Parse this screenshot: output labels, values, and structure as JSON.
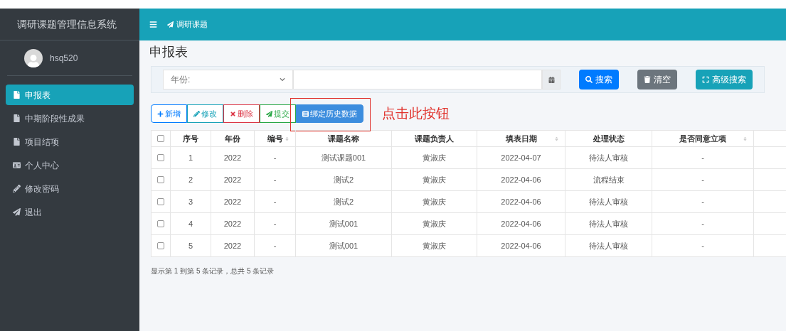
{
  "sidebar": {
    "brand": "调研课题管理信息系统",
    "user": {
      "name": "hsq520"
    },
    "items": [
      {
        "label": "申报表",
        "selected": true
      },
      {
        "label": "中期阶段性成果",
        "selected": false
      },
      {
        "label": "项目结项",
        "selected": false
      },
      {
        "label": "个人中心",
        "selected": false
      },
      {
        "label": "修改密码",
        "selected": false
      },
      {
        "label": "退出",
        "selected": false
      }
    ]
  },
  "header": {
    "breadcrumb": "调研课题"
  },
  "page_title": "申报表",
  "search": {
    "year_select": {
      "placeholder": "年份:"
    },
    "buttons": [
      {
        "kind": "search",
        "label": "搜索"
      },
      {
        "kind": "clear",
        "label": "清空"
      },
      {
        "kind": "advanced",
        "label": "高级搜索"
      }
    ]
  },
  "toolbar": [
    {
      "kind": "add",
      "label": "新增",
      "highlighted": false
    },
    {
      "kind": "edit",
      "label": "修改",
      "highlighted": false
    },
    {
      "kind": "delete",
      "label": "删除",
      "highlighted": false
    },
    {
      "kind": "submit",
      "label": "提交",
      "highlighted": false
    },
    {
      "kind": "bind",
      "label": "绑定历史数据",
      "highlighted": true
    }
  ],
  "annotation": "点击此按钮",
  "table": {
    "select_all_checked": false,
    "columns": [
      {
        "label": "序号",
        "sortable": false
      },
      {
        "label": "年份",
        "sortable": false
      },
      {
        "label": "编号",
        "sortable": true
      },
      {
        "label": "课题名称",
        "sortable": false
      },
      {
        "label": "课题负责人",
        "sortable": false
      },
      {
        "label": "填表日期",
        "sortable": true
      },
      {
        "label": "处理状态",
        "sortable": false
      },
      {
        "label": "是否同意立项",
        "sortable": true
      }
    ],
    "rows": [
      {
        "checked": false,
        "cells": [
          "1",
          "2022",
          "-",
          "测试课题001",
          "黄淑庆",
          "2022-04-07",
          "待法人审核",
          "-"
        ]
      },
      {
        "checked": false,
        "cells": [
          "2",
          "2022",
          "-",
          "测试2",
          "黄淑庆",
          "2022-04-06",
          "流程结束",
          "-"
        ]
      },
      {
        "checked": false,
        "cells": [
          "3",
          "2022",
          "-",
          "测试2",
          "黄淑庆",
          "2022-04-06",
          "待法人审核",
          "-"
        ]
      },
      {
        "checked": false,
        "cells": [
          "4",
          "2022",
          "-",
          "测试001",
          "黄淑庆",
          "2022-04-06",
          "待法人审核",
          "-"
        ]
      },
      {
        "checked": false,
        "cells": [
          "5",
          "2022",
          "-",
          "测试001",
          "黄淑庆",
          "2022-04-06",
          "待法人审核",
          "-"
        ]
      }
    ]
  },
  "pagination_info": "显示第 1 到第 5 条记录，总共 5 条记录"
}
